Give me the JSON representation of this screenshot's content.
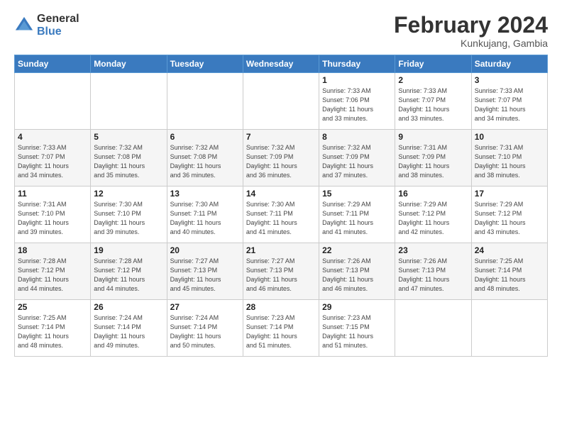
{
  "logo": {
    "general": "General",
    "blue": "Blue"
  },
  "header": {
    "month_year": "February 2024",
    "location": "Kunkujang, Gambia"
  },
  "weekdays": [
    "Sunday",
    "Monday",
    "Tuesday",
    "Wednesday",
    "Thursday",
    "Friday",
    "Saturday"
  ],
  "weeks": [
    [
      {
        "day": "",
        "info": ""
      },
      {
        "day": "",
        "info": ""
      },
      {
        "day": "",
        "info": ""
      },
      {
        "day": "",
        "info": ""
      },
      {
        "day": "1",
        "info": "Sunrise: 7:33 AM\nSunset: 7:06 PM\nDaylight: 11 hours\nand 33 minutes."
      },
      {
        "day": "2",
        "info": "Sunrise: 7:33 AM\nSunset: 7:07 PM\nDaylight: 11 hours\nand 33 minutes."
      },
      {
        "day": "3",
        "info": "Sunrise: 7:33 AM\nSunset: 7:07 PM\nDaylight: 11 hours\nand 34 minutes."
      }
    ],
    [
      {
        "day": "4",
        "info": "Sunrise: 7:33 AM\nSunset: 7:07 PM\nDaylight: 11 hours\nand 34 minutes."
      },
      {
        "day": "5",
        "info": "Sunrise: 7:32 AM\nSunset: 7:08 PM\nDaylight: 11 hours\nand 35 minutes."
      },
      {
        "day": "6",
        "info": "Sunrise: 7:32 AM\nSunset: 7:08 PM\nDaylight: 11 hours\nand 36 minutes."
      },
      {
        "day": "7",
        "info": "Sunrise: 7:32 AM\nSunset: 7:09 PM\nDaylight: 11 hours\nand 36 minutes."
      },
      {
        "day": "8",
        "info": "Sunrise: 7:32 AM\nSunset: 7:09 PM\nDaylight: 11 hours\nand 37 minutes."
      },
      {
        "day": "9",
        "info": "Sunrise: 7:31 AM\nSunset: 7:09 PM\nDaylight: 11 hours\nand 38 minutes."
      },
      {
        "day": "10",
        "info": "Sunrise: 7:31 AM\nSunset: 7:10 PM\nDaylight: 11 hours\nand 38 minutes."
      }
    ],
    [
      {
        "day": "11",
        "info": "Sunrise: 7:31 AM\nSunset: 7:10 PM\nDaylight: 11 hours\nand 39 minutes."
      },
      {
        "day": "12",
        "info": "Sunrise: 7:30 AM\nSunset: 7:10 PM\nDaylight: 11 hours\nand 39 minutes."
      },
      {
        "day": "13",
        "info": "Sunrise: 7:30 AM\nSunset: 7:11 PM\nDaylight: 11 hours\nand 40 minutes."
      },
      {
        "day": "14",
        "info": "Sunrise: 7:30 AM\nSunset: 7:11 PM\nDaylight: 11 hours\nand 41 minutes."
      },
      {
        "day": "15",
        "info": "Sunrise: 7:29 AM\nSunset: 7:11 PM\nDaylight: 11 hours\nand 41 minutes."
      },
      {
        "day": "16",
        "info": "Sunrise: 7:29 AM\nSunset: 7:12 PM\nDaylight: 11 hours\nand 42 minutes."
      },
      {
        "day": "17",
        "info": "Sunrise: 7:29 AM\nSunset: 7:12 PM\nDaylight: 11 hours\nand 43 minutes."
      }
    ],
    [
      {
        "day": "18",
        "info": "Sunrise: 7:28 AM\nSunset: 7:12 PM\nDaylight: 11 hours\nand 44 minutes."
      },
      {
        "day": "19",
        "info": "Sunrise: 7:28 AM\nSunset: 7:12 PM\nDaylight: 11 hours\nand 44 minutes."
      },
      {
        "day": "20",
        "info": "Sunrise: 7:27 AM\nSunset: 7:13 PM\nDaylight: 11 hours\nand 45 minutes."
      },
      {
        "day": "21",
        "info": "Sunrise: 7:27 AM\nSunset: 7:13 PM\nDaylight: 11 hours\nand 46 minutes."
      },
      {
        "day": "22",
        "info": "Sunrise: 7:26 AM\nSunset: 7:13 PM\nDaylight: 11 hours\nand 46 minutes."
      },
      {
        "day": "23",
        "info": "Sunrise: 7:26 AM\nSunset: 7:13 PM\nDaylight: 11 hours\nand 47 minutes."
      },
      {
        "day": "24",
        "info": "Sunrise: 7:25 AM\nSunset: 7:14 PM\nDaylight: 11 hours\nand 48 minutes."
      }
    ],
    [
      {
        "day": "25",
        "info": "Sunrise: 7:25 AM\nSunset: 7:14 PM\nDaylight: 11 hours\nand 48 minutes."
      },
      {
        "day": "26",
        "info": "Sunrise: 7:24 AM\nSunset: 7:14 PM\nDaylight: 11 hours\nand 49 minutes."
      },
      {
        "day": "27",
        "info": "Sunrise: 7:24 AM\nSunset: 7:14 PM\nDaylight: 11 hours\nand 50 minutes."
      },
      {
        "day": "28",
        "info": "Sunrise: 7:23 AM\nSunset: 7:14 PM\nDaylight: 11 hours\nand 51 minutes."
      },
      {
        "day": "29",
        "info": "Sunrise: 7:23 AM\nSunset: 7:15 PM\nDaylight: 11 hours\nand 51 minutes."
      },
      {
        "day": "",
        "info": ""
      },
      {
        "day": "",
        "info": ""
      }
    ]
  ]
}
